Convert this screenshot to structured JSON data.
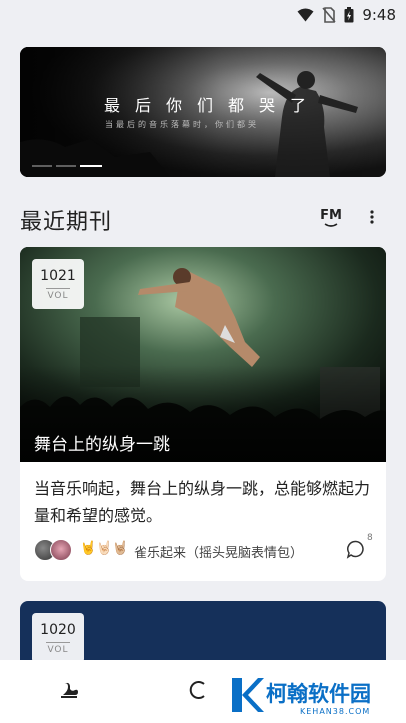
{
  "status_bar": {
    "time": "9:48",
    "icons": [
      "wifi-icon",
      "no-sim-icon",
      "battery-icon"
    ]
  },
  "banner": {
    "title": "最后你们都哭了",
    "subtitle": "当最后的音乐落幕时，你们都哭",
    "page_count": 3,
    "active_index": 2
  },
  "section": {
    "title": "最近期刊",
    "fm_label": "FM",
    "more_icon": "more-vertical-icon"
  },
  "issues": [
    {
      "vol_number": "1021",
      "vol_label": "VOL",
      "image_title": "舞台上的纵身一跳",
      "description": "当音乐响起，舞台上的纵身一跳，总能够燃起力量和希望的感觉。",
      "emojis": "🤘🤘🏻🤘🏼",
      "footer_text": "雀乐起来（摇头晃脑表情包）",
      "comment_count": "8"
    },
    {
      "vol_number": "1020",
      "vol_label": "VOL"
    }
  ],
  "nav": {
    "icons": [
      "swan-logo-icon",
      "search-icon"
    ]
  },
  "watermark": {
    "text": "柯翰软件园",
    "url": "KEHAN38.COM"
  },
  "colors": {
    "background": "#eeeff3",
    "card": "#ffffff",
    "card2": "#15305a",
    "watermark": "#0a6fc6"
  }
}
